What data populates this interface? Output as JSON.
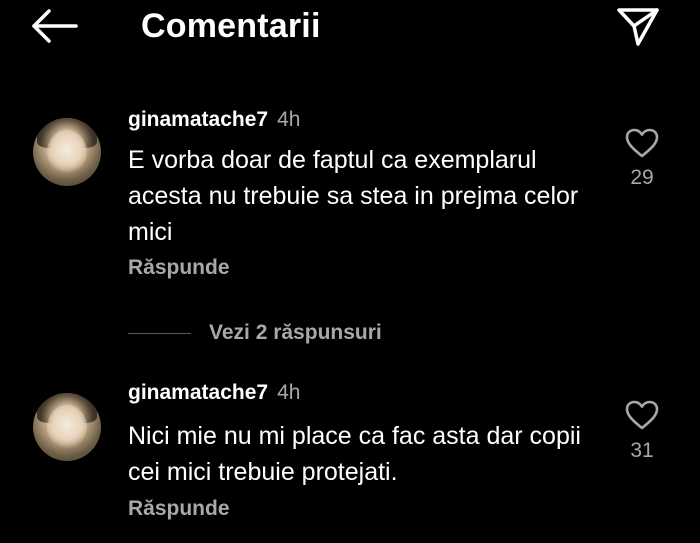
{
  "header": {
    "title": "Comentarii",
    "back_icon": "arrow-left-icon",
    "share_icon": "paper-plane-icon"
  },
  "comments": [
    {
      "username": "ginamatache7",
      "time": "4h",
      "text": "E vorba doar de faptul ca exemplarul acesta nu trebuie sa stea in prejma celor mici",
      "reply_label": "Răspunde",
      "likes": "29",
      "like_icon": "heart-outline-icon"
    },
    {
      "username": "ginamatache7",
      "time": "4h",
      "text": "Nici mie nu mi place ca fac asta dar copii cei mici trebuie protejati.",
      "reply_label": "Răspunde",
      "likes": "31",
      "like_icon": "heart-outline-icon"
    }
  ],
  "view_replies_label": "Vezi 2 răspunsuri",
  "colors": {
    "background": "#000000",
    "text_primary": "#ffffff",
    "text_secondary": "#a8a8a8"
  }
}
